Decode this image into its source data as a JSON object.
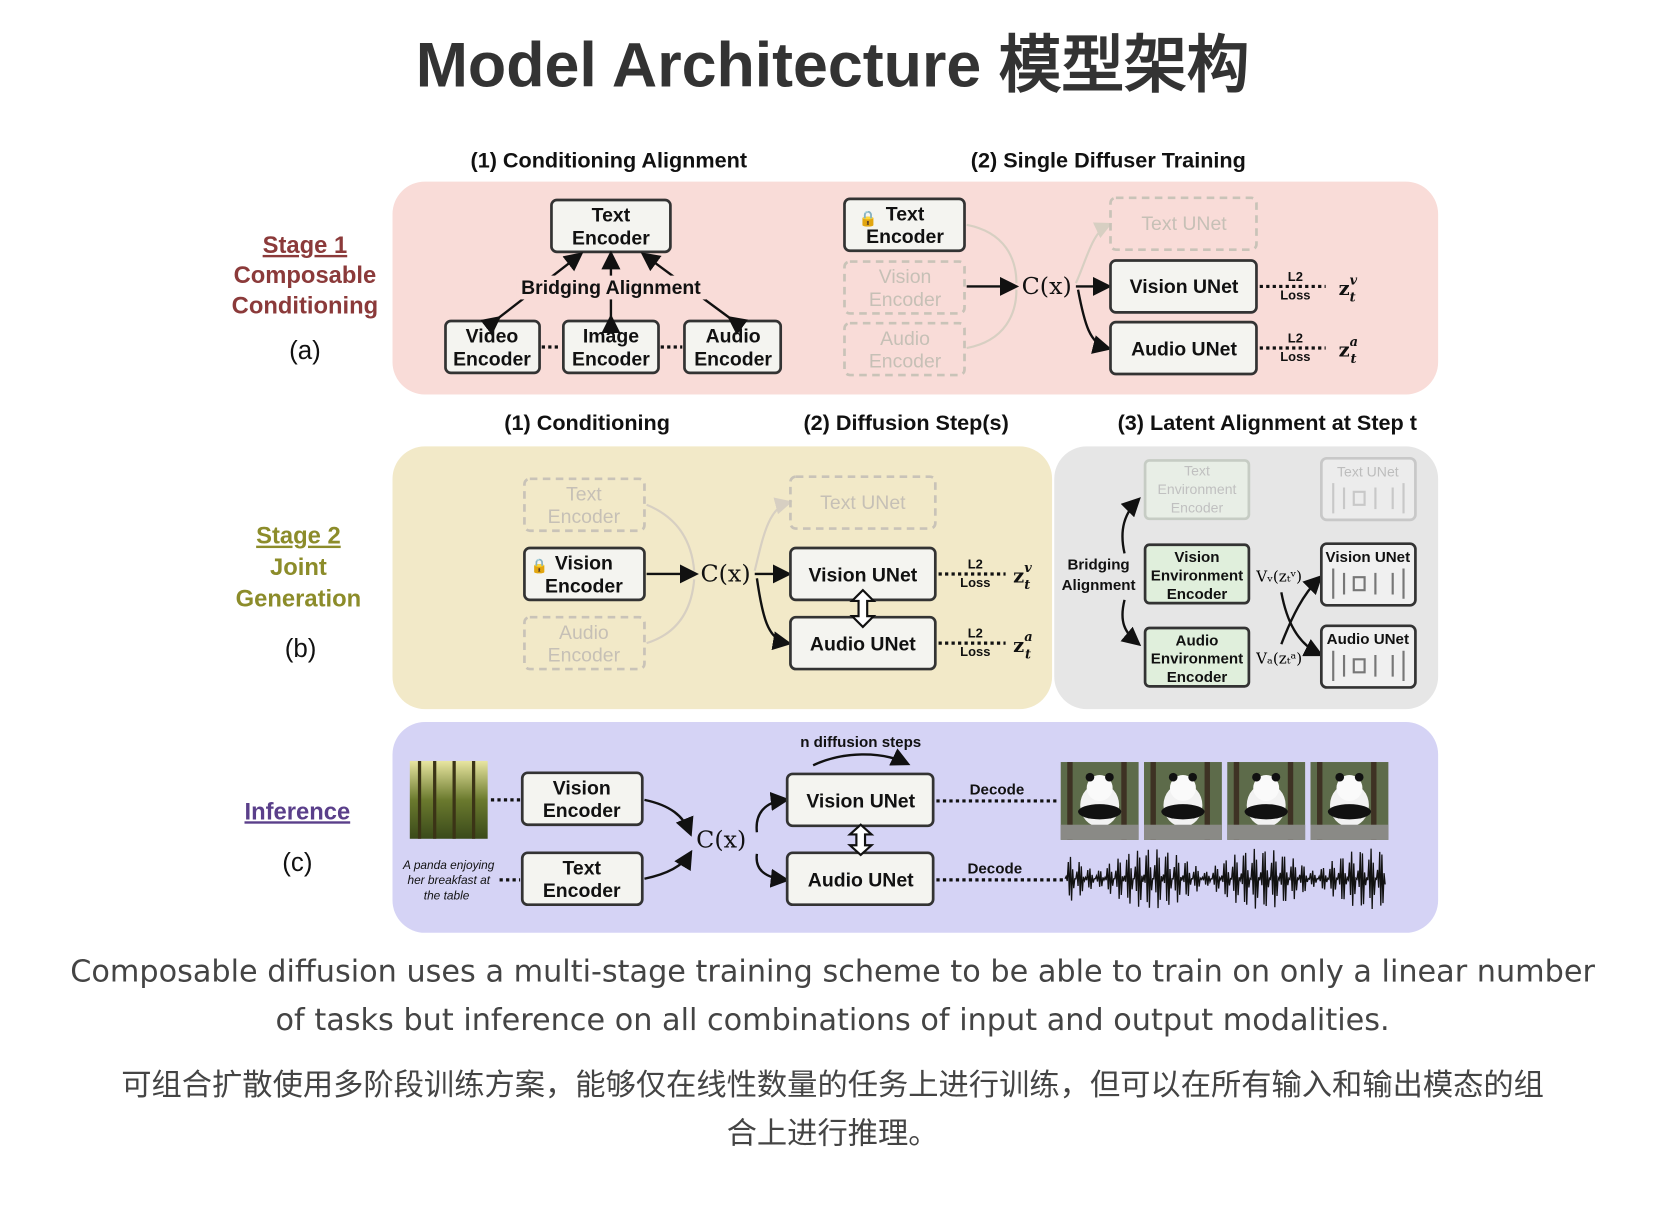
{
  "title": "Model Architecture 模型架构",
  "colors": {
    "stage1_panel": "#f9dcd8",
    "stage2_panel": "#f2e9c8",
    "latent_panel": "#e6e6e6",
    "inference_panel": "#d5d3f5",
    "stage1_label": "#8b3a3a",
    "stage2_label": "#8c8c2a",
    "inference_label": "#5a3f8a"
  },
  "stage1": {
    "label": "Stage 1",
    "line2": "Composable",
    "line3": "Conditioning",
    "tag": "(a)",
    "header1": "(1) Conditioning Alignment",
    "header2": "(2) Single Diffuser Training",
    "bridging": "Bridging Alignment",
    "text_enc": [
      "Text",
      "Encoder"
    ],
    "video_enc": [
      "Video",
      "Encoder"
    ],
    "image_enc": [
      "Image",
      "Encoder"
    ],
    "audio_enc": [
      "Audio",
      "Encoder"
    ],
    "cx": "C(x)",
    "vision_enc": [
      "Vision",
      "Encoder"
    ],
    "text_unet": "Text UNet",
    "vision_unet": "Vision UNet",
    "audio_unet": "Audio UNet",
    "l2": "L2",
    "loss": "Loss",
    "z": "z",
    "zv": "v",
    "za": "a",
    "t": "t"
  },
  "stage2": {
    "label": "Stage 2",
    "line2": "Joint",
    "line3": "Generation",
    "tag": "(b)",
    "header1": "(1) Conditioning",
    "header2": "(2) Diffusion Step(s)",
    "header3": "(3) Latent Alignment at Step t",
    "bridging": [
      "Bridging",
      "Alignment"
    ],
    "text_env": [
      "Text",
      "Environment",
      "Encoder"
    ],
    "vision_env": [
      "Vision",
      "Environment",
      "Encoder"
    ],
    "audio_env": [
      "Audio",
      "Environment",
      "Encoder"
    ],
    "vv": "Vᵥ(zₜᵛ)",
    "va": "Vₐ(zₜᵃ)"
  },
  "inference": {
    "label": "Inference",
    "tag": "(c)",
    "prompt": [
      "A panda enjoying",
      "her breakfast at",
      "the table"
    ],
    "n_steps": "n diffusion steps",
    "decode": "Decode"
  },
  "caption_en": [
    "Composable diffusion uses a multi-stage training scheme to be able to train on only a linear number",
    "of tasks but inference on all combinations of input and output modalities."
  ],
  "caption_zh": [
    "可组合扩散使用多阶段训练方案，能够仅在线性数量的任务上进行训练，但可以在所有输入和输出模态的组",
    "合上进行推理。"
  ]
}
